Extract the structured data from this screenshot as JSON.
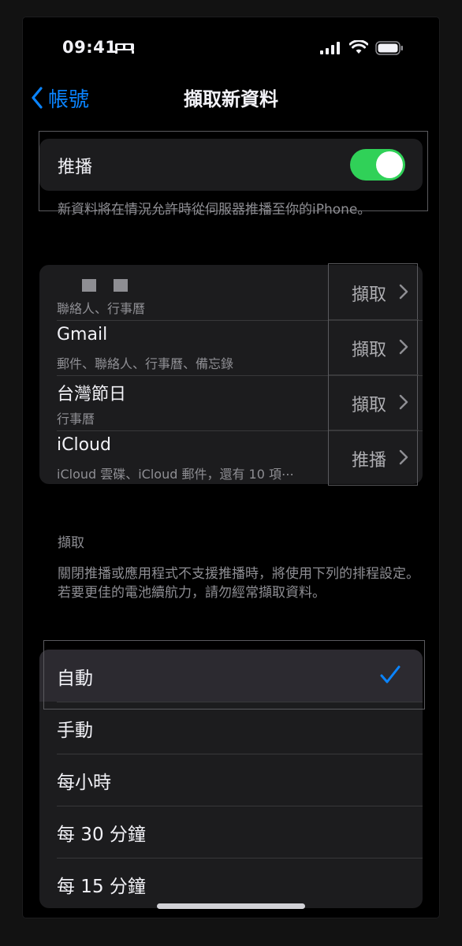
{
  "status_bar": {
    "time": "09:41"
  },
  "nav": {
    "back_label": "帳號",
    "title": "擷取新資料"
  },
  "push": {
    "label": "推播",
    "enabled": true,
    "footer": "新資料將在情況允許時從伺服器推播至你的iPhone。"
  },
  "accounts": [
    {
      "name": "",
      "redacted": true,
      "detail": "聯絡人、行事曆",
      "value": "擷取"
    },
    {
      "name": "Gmail",
      "redacted": false,
      "detail": "郵件、聯絡人、行事曆、備忘錄",
      "value": "擷取"
    },
    {
      "name": "台灣節日",
      "redacted": false,
      "detail": "行事曆",
      "value": "擷取"
    },
    {
      "name": "iCloud",
      "redacted": false,
      "detail": "iCloud 雲碟、iCloud 郵件，還有 10 項⋯",
      "value": "推播"
    }
  ],
  "fetch": {
    "header": "擷取",
    "description": "關閉推播或應用程式不支援推播時，將使用下列的排程設定。若要更佳的電池續航力，請勿經常擷取資料。",
    "options": [
      {
        "label": "自動",
        "selected": true
      },
      {
        "label": "手動",
        "selected": false
      },
      {
        "label": "每小時",
        "selected": false
      },
      {
        "label": "每 30 分鐘",
        "selected": false
      },
      {
        "label": "每 15 分鐘",
        "selected": false
      }
    ]
  },
  "colors": {
    "accent": "#0a84ff",
    "toggle_on": "#30d158",
    "background": "#000000",
    "cell": "#1c1c1e",
    "secondary_text": "#8e8e93"
  },
  "icons": [
    "bed-icon",
    "signal-icon",
    "wifi-icon",
    "battery-icon",
    "chevron-left-icon",
    "chevron-right-icon",
    "checkmark-icon"
  ]
}
